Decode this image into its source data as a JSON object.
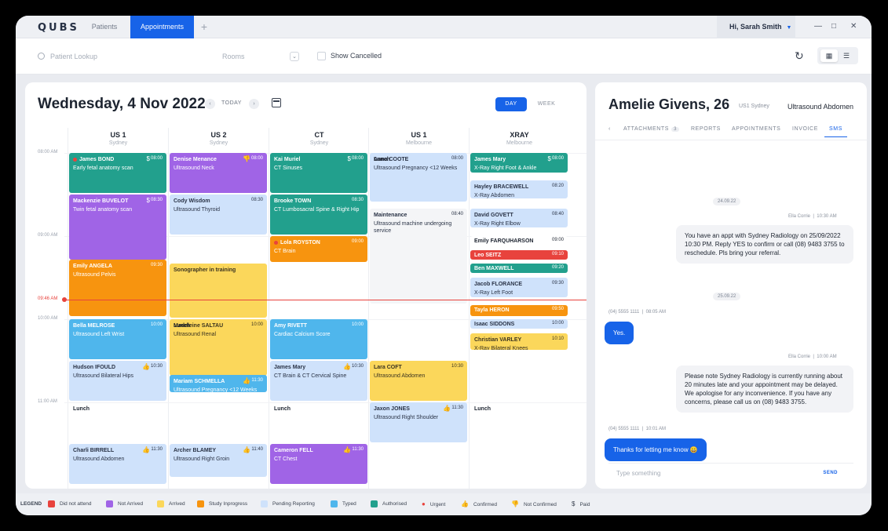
{
  "app": {
    "logo": "QUBS",
    "tabs": [
      "Patients",
      "Appointments"
    ],
    "add_tab": "+",
    "user": "Hi, Sarah Smith",
    "window": {
      "minimize": "—",
      "maximize": "□",
      "close": "✕"
    }
  },
  "toolbar": {
    "search_placeholder": "Patient Lookup",
    "rooms_placeholder": "Rooms",
    "show_cancelled": "Show Cancelled"
  },
  "calendar": {
    "title": "Wednesday, 4 Nov 2022",
    "today": "TODAY",
    "day": "DAY",
    "week": "WEEK",
    "columns": [
      {
        "name": "US 1",
        "location": "Sydney"
      },
      {
        "name": "US 2",
        "location": "Sydney"
      },
      {
        "name": "CT",
        "location": "Sydney"
      },
      {
        "name": "US 1",
        "location": "Melbourne"
      },
      {
        "name": "XRAY",
        "location": "Melbourne"
      }
    ],
    "times": [
      "08:00 AM",
      "09:00 AM",
      "10:00 AM",
      "11:00 AM"
    ],
    "now_label": "09:46 AM",
    "appointments": [
      {
        "col": 0,
        "name": "James BOND",
        "desc": "Early fetal anatomy scan",
        "time": "08:00",
        "color": "teal",
        "icon": "$",
        "dot": true
      },
      {
        "col": 0,
        "name": "Mackenzie BUVELOT",
        "desc": "Twin fetal anatomy scan",
        "time": "08:30",
        "color": "purple",
        "icon": "$"
      },
      {
        "col": 0,
        "name": "Emily ANGELA",
        "desc": "Ultrasound Pelvis",
        "time": "09:30",
        "color": "orange"
      },
      {
        "col": 0,
        "name": "Bella MELROSE",
        "desc": "Ultrasound Left Wrist",
        "time": "10:00",
        "color": "blue"
      },
      {
        "col": 0,
        "name": "Hudson IFOULD",
        "desc": "Ultrasound Bilateral Hips",
        "time": "10:30",
        "color": "lblue",
        "icon": "👍"
      },
      {
        "col": 0,
        "name": "Lunch",
        "desc": "",
        "time": "",
        "color": "hatch"
      },
      {
        "col": 0,
        "name": "Charli BIRRELL",
        "desc": "Ultrasound Abdomen",
        "time": "11:30",
        "color": "lblue",
        "icon": "👍"
      },
      {
        "col": 1,
        "name": "Denise Menance",
        "desc": "Ultrasound Neck",
        "time": "08:00",
        "color": "purple",
        "icon": "👎"
      },
      {
        "col": 1,
        "name": "Cody Wisdom",
        "desc": "Ultrasound Thyroid",
        "time": "08:30",
        "color": "lblue"
      },
      {
        "col": 1,
        "name": "Sonographer in training",
        "desc": "",
        "time": "",
        "color": "yellow"
      },
      {
        "col": 1,
        "name": "Madeleine SALTAU",
        "desc": "Ultrasound Renal",
        "time": "10:00",
        "color": "yellow"
      },
      {
        "col": 1,
        "name": "Lunch",
        "desc": "",
        "time": "",
        "color": "hatch"
      },
      {
        "col": 1,
        "name": "Mariam SCHMELLA",
        "desc": "Ultrasound Pregnancy <12 Weeks",
        "time": "11:30",
        "color": "blue",
        "icon": "👍"
      },
      {
        "col": 1,
        "name": "Archer BLAMEY",
        "desc": "Ultrasound Right Groin",
        "time": "11:40",
        "color": "lblue",
        "icon": "👍"
      },
      {
        "col": 2,
        "name": "Kai Muriel",
        "desc": "CT Sinuses",
        "time": "08:00",
        "color": "teal",
        "icon": "$"
      },
      {
        "col": 2,
        "name": "Brooke TOWN",
        "desc": "CT Lumbosacral Spine & Right Hip",
        "time": "08:30",
        "color": "teal"
      },
      {
        "col": 2,
        "name": "Lola ROYSTON",
        "desc": "CT Brain",
        "time": "09:00",
        "color": "orange",
        "dot": true
      },
      {
        "col": 2,
        "name": "Amy RIVETT",
        "desc": "Cardiac Calcium Score",
        "time": "10:00",
        "color": "blue"
      },
      {
        "col": 2,
        "name": "James Mary",
        "desc": "CT Brain & CT Cervical Spine",
        "time": "10:30",
        "color": "lblue",
        "icon": "👍"
      },
      {
        "col": 2,
        "name": "Lunch",
        "desc": "",
        "time": "",
        "color": "hatch"
      },
      {
        "col": 2,
        "name": "Cameron FELL",
        "desc": "CT Chest",
        "time": "11:30",
        "color": "purple",
        "icon": "👍"
      },
      {
        "col": 3,
        "name": "Anna COOTE",
        "desc": "Ultrasound Pregnancy <12 Weeks",
        "time": "08:00",
        "color": "lblue"
      },
      {
        "col": 3,
        "name": "Maintenance",
        "desc": "Ultrasound machine undergoing service",
        "time": "08:40",
        "color": "grey"
      },
      {
        "col": 3,
        "name": "Lara COFT",
        "desc": "Ultrasound Abdomen",
        "time": "10:30",
        "color": "yellow"
      },
      {
        "col": 3,
        "name": "Lunch",
        "desc": "",
        "time": "",
        "color": "hatch"
      },
      {
        "col": 3,
        "name": "Jaxon JONES",
        "desc": "Ultrasound Right Shoulder",
        "time": "11:30",
        "color": "lblue",
        "icon": "👍"
      },
      {
        "col": 4,
        "name": "James Mary",
        "desc": "X-Ray Right Foot & Ankle",
        "time": "08:00",
        "color": "teal",
        "icon": "$"
      },
      {
        "col": 4,
        "name": "Hayley BRACEWELL",
        "desc": "X-Ray Abdomen",
        "time": "08:20",
        "color": "lblue"
      },
      {
        "col": 4,
        "name": "David GOVETT",
        "desc": "X-Ray Right Elbow",
        "time": "08:40",
        "color": "lblue"
      },
      {
        "col": 4,
        "name": "Emily FARQUHARSON",
        "desc": "",
        "time": "09:00",
        "color": "white"
      },
      {
        "col": 4,
        "name": "Leo SEITZ",
        "desc": "",
        "time": "09:10",
        "color": "red"
      },
      {
        "col": 4,
        "name": "Ben MAXWELL",
        "desc": "",
        "time": "09:20",
        "color": "teal"
      },
      {
        "col": 4,
        "name": "Jacob FLORANCE",
        "desc": "X-Ray Left Foot",
        "time": "09:30",
        "color": "lblue"
      },
      {
        "col": 4,
        "name": "Tayla HERON",
        "desc": "",
        "time": "09:50",
        "color": "orange"
      },
      {
        "col": 4,
        "name": "Isaac SIDDONS",
        "desc": "",
        "time": "10:00",
        "color": "lblue"
      },
      {
        "col": 4,
        "name": "Christian VARLEY",
        "desc": "X-Ray Bilateral Knees",
        "time": "10:10",
        "color": "yellow"
      },
      {
        "col": 4,
        "name": "Lunch",
        "desc": "",
        "time": "",
        "color": "hatch"
      }
    ]
  },
  "patient": {
    "name": "Amelie Givens, 26",
    "location": "US1 Sydney",
    "exam": "Ultrasound Abdomen",
    "tabs": {
      "attachments": "ATTACHMENTS",
      "attachments_count": "3",
      "reports": "REPORTS",
      "appointments": "APPOINTMENTS",
      "invoice": "INVOICE",
      "sms": "SMS"
    },
    "messages": {
      "date1": "24.09.22",
      "meta1_sender": "Ella Corrie",
      "meta1_time": "10:30 AM",
      "out1": "You have an appt with  Sydney Radiology on 25/09/2022 10:30 PM. Reply YES to confirm or call (08) 9483 3755  to reschedule. Pls bring your referral.",
      "date2": "25.09.22",
      "meta2_sender": "(04) 5555 1111",
      "meta2_time": "08:05 AM",
      "in1": "Yes.",
      "meta3_sender": "Ella Corrie",
      "meta3_time": "10:00 AM",
      "out2": "Please note Sydney Radiology is currently running about 20 minutes late and your appointment may be delayed. We apologise for any inconvenience. If you have any concerns, please call us on (08) 9483 3755.",
      "meta4_sender": "(04) 5555 1111",
      "meta4_time": "10:01 AM",
      "in2": "Thanks for letting me know 😀"
    },
    "compose_placeholder": "Type something",
    "send": "SEND"
  },
  "legend": {
    "title": "LEGEND",
    "items": [
      {
        "label": "Did not attend",
        "color": "#e8433d"
      },
      {
        "label": "Not Arrived",
        "color": "#a064e6"
      },
      {
        "label": "Arrived",
        "color": "#fbd75b"
      },
      {
        "label": "Study Inprogress",
        "color": "#f7940f"
      },
      {
        "label": "Pending Reporting",
        "color": "#cfe2fb"
      },
      {
        "label": "Typed",
        "color": "#4fb6ec"
      },
      {
        "label": "Authorised",
        "color": "#22a08d"
      },
      {
        "label": "Urgent",
        "icon": "urgent-dot-icon"
      },
      {
        "label": "Confirmed",
        "icon": "thumbs-up-icon"
      },
      {
        "label": "Not Confirmed",
        "icon": "thumbs-down-icon"
      },
      {
        "label": "Paid",
        "icon": "dollar-icon"
      }
    ]
  }
}
